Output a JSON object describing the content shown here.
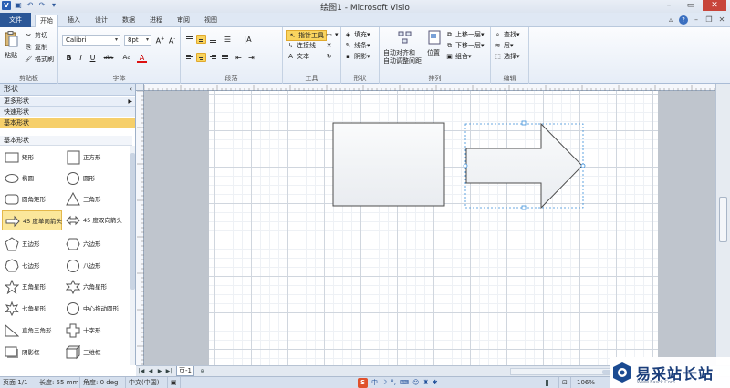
{
  "window": {
    "title": "绘图1 - Microsoft Visio"
  },
  "quick_access": [
    "visio-app-icon",
    "save-icon",
    "undo-icon",
    "redo-icon",
    "customize-icon"
  ],
  "tabs": [
    {
      "label": "文件"
    },
    {
      "label": "开始"
    },
    {
      "label": "插入"
    },
    {
      "label": "设计"
    },
    {
      "label": "数据"
    },
    {
      "label": "进程"
    },
    {
      "label": "审阅"
    },
    {
      "label": "视图"
    }
  ],
  "ribbon": {
    "clipboard": {
      "paste": "粘贴",
      "cut": "剪切",
      "copy": "复制",
      "format_painter": "格式刷",
      "label": "剪贴板"
    },
    "font": {
      "family": "Calibri",
      "size": "8pt",
      "bold": "B",
      "italic": "I",
      "underline": "U",
      "strike": "abc",
      "aa": "Aa",
      "color": "A",
      "label": "字体"
    },
    "paragraph": {
      "label": "段落"
    },
    "tools": {
      "pointer": "指针工具",
      "connector": "连接线",
      "text": "文本",
      "label": "工具"
    },
    "shape": {
      "fill": "填充",
      "line": "线条",
      "shadow": "阴影",
      "label": "形状"
    },
    "arrange": {
      "auto_align": "自动对齐和",
      "auto_space": "自动调整间距",
      "position": "位置",
      "bring_forward": "上移一层",
      "send_backward": "下移一层",
      "group": "组合",
      "label": "排列"
    },
    "editing": {
      "find": "查找",
      "layers": "层",
      "select": "选择",
      "label": "编辑"
    }
  },
  "shapes_panel": {
    "title": "形状",
    "more_shapes": "更多形状",
    "quick_shapes": "快速形状",
    "basic_shapes": "基本形状",
    "stencil_header": "基本形状",
    "items": [
      {
        "label": "矩形",
        "icon": "rectangle-shape-icon"
      },
      {
        "label": "正方形",
        "icon": "square-shape-icon"
      },
      {
        "label": "椭圆",
        "icon": "ellipse-shape-icon"
      },
      {
        "label": "圆形",
        "icon": "circle-shape-icon"
      },
      {
        "label": "圆角矩形",
        "icon": "rounded-rectangle-shape-icon"
      },
      {
        "label": "三角形",
        "icon": "triangle-shape-icon"
      },
      {
        "label": "45 度单向箭头",
        "icon": "single-arrow-shape-icon",
        "selected": true
      },
      {
        "label": "45 度双向箭头",
        "icon": "double-arrow-shape-icon"
      },
      {
        "label": "五边形",
        "icon": "pentagon-shape-icon"
      },
      {
        "label": "六边形",
        "icon": "hexagon-shape-icon"
      },
      {
        "label": "七边形",
        "icon": "heptagon-shape-icon"
      },
      {
        "label": "八边形",
        "icon": "octagon-shape-icon"
      },
      {
        "label": "五角星形",
        "icon": "five-point-star-shape-icon"
      },
      {
        "label": "六角星形",
        "icon": "six-point-star-shape-icon"
      },
      {
        "label": "七角星形",
        "icon": "seven-point-star-shape-icon"
      },
      {
        "label": "中心拖动圆形",
        "icon": "center-drag-circle-shape-icon"
      },
      {
        "label": "直角三角形",
        "icon": "right-triangle-shape-icon"
      },
      {
        "label": "十字形",
        "icon": "cross-shape-icon"
      },
      {
        "label": "阴影框",
        "icon": "shadow-box-shape-icon"
      },
      {
        "label": "三维框",
        "icon": "3d-box-shape-icon"
      }
    ]
  },
  "page_tabs": {
    "current": "页-1"
  },
  "status": {
    "page": "页面 1/1",
    "length": "长度: 55 mm",
    "angle": "角度: 0 deg",
    "language": "中文(中国)",
    "zoom": "106%"
  },
  "ime_bar": {
    "s_logo": "S",
    "mode": "中"
  },
  "watermark": {
    "text": "易采站长站",
    "sub": "Www.Easck.Com"
  },
  "colors": {
    "file_tab": "#2b5797",
    "selection": "#f6cf6a",
    "shape_fill": "#f3f4f6",
    "shape_stroke": "#4c4c4c",
    "selection_handle": "#3b8fd9"
  }
}
